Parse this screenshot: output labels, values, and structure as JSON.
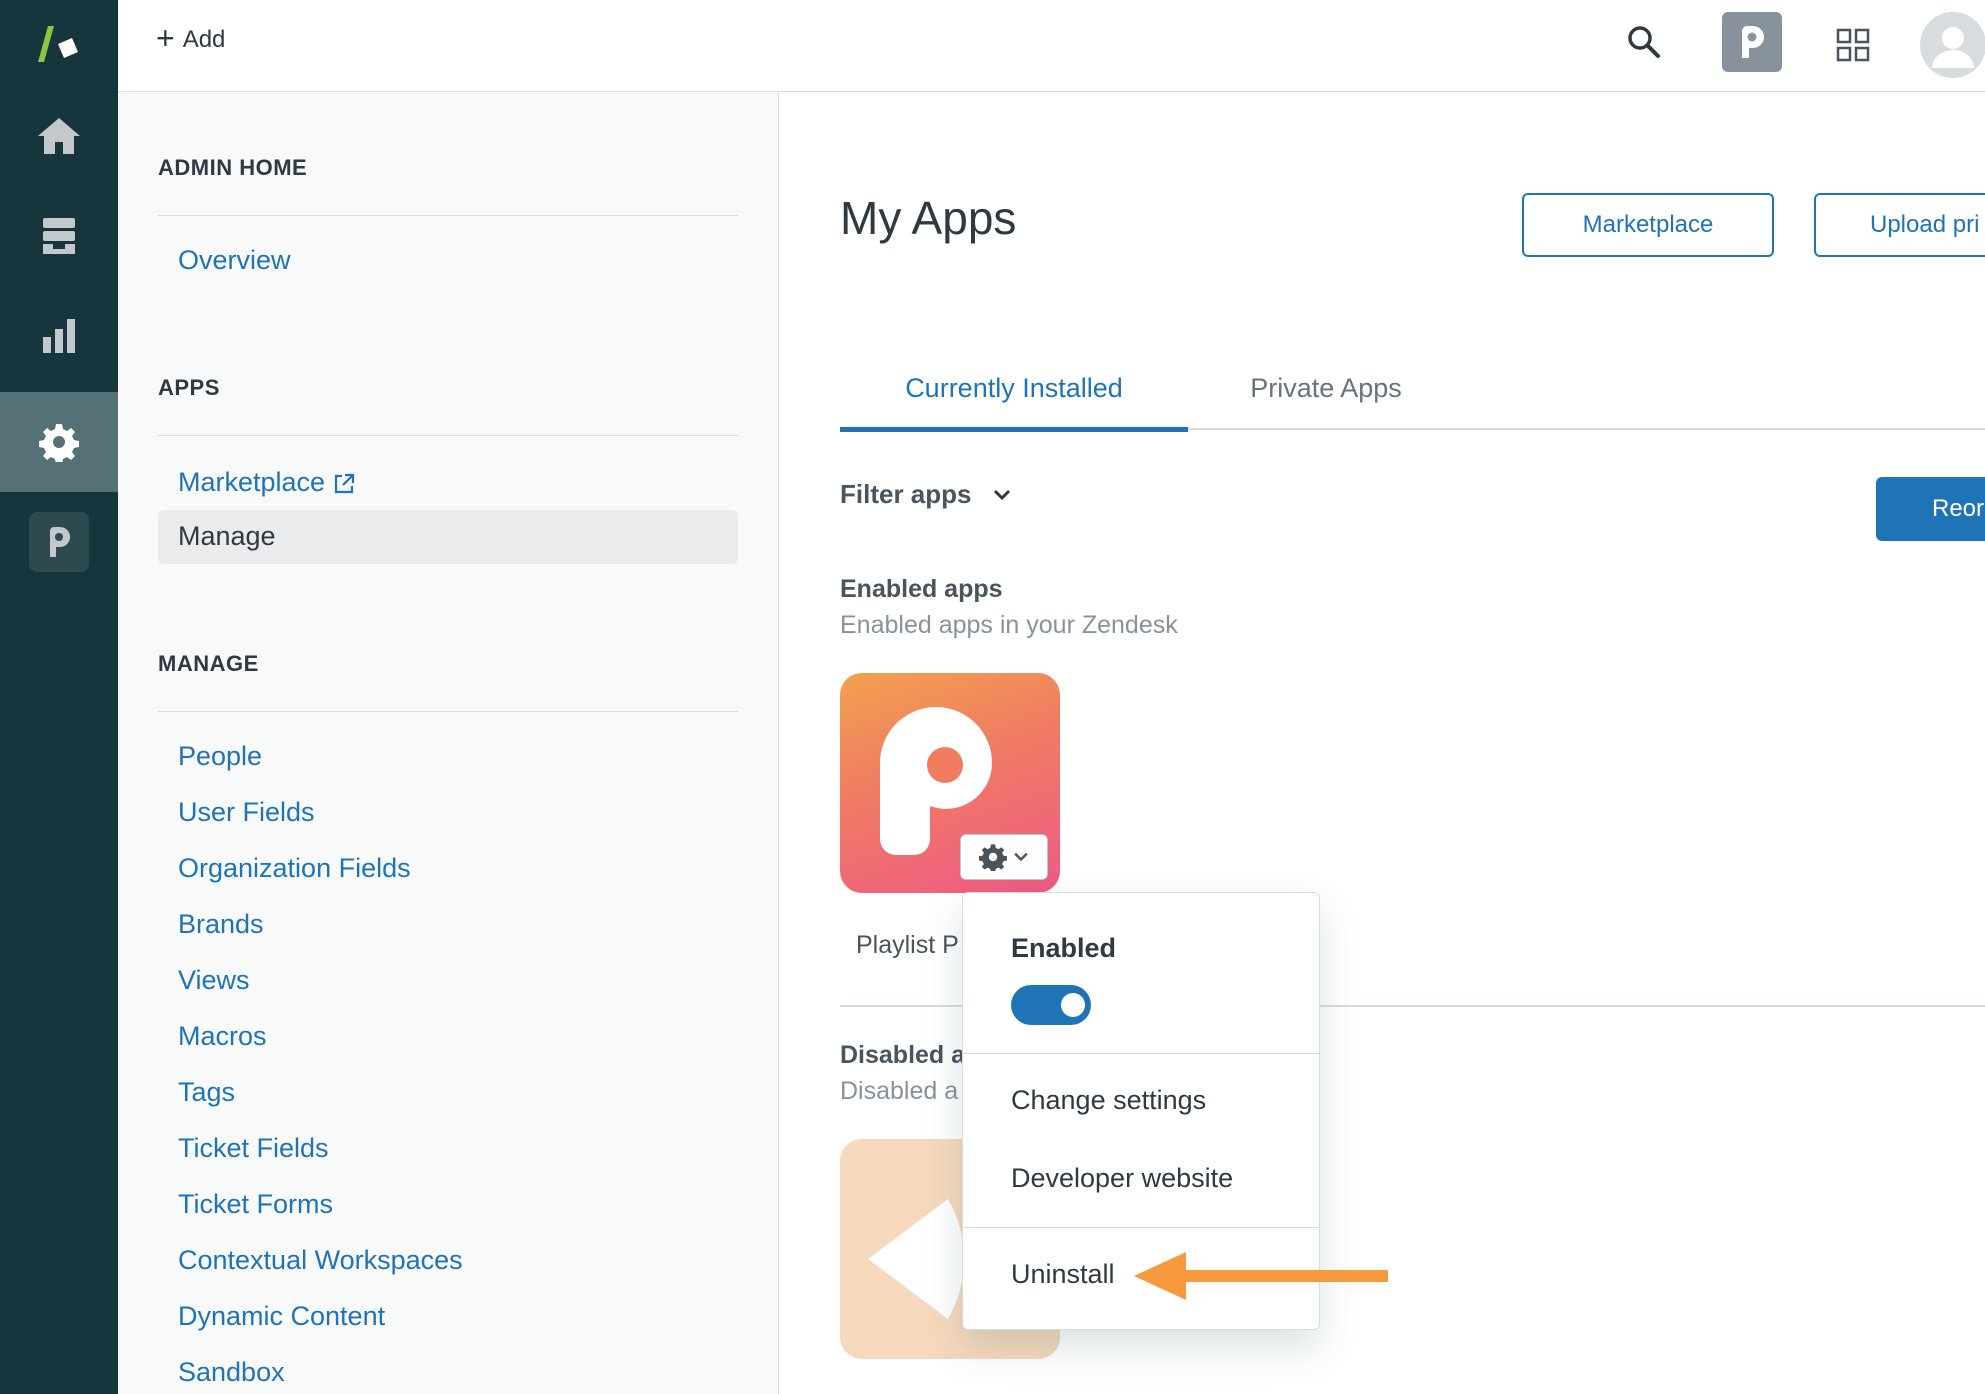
{
  "topbar": {
    "add_label": "Add"
  },
  "sidebar": {
    "admin_home_heading": "ADMIN HOME",
    "overview_label": "Overview",
    "apps_heading": "APPS",
    "marketplace_label": "Marketplace",
    "manage_selected_label": "Manage",
    "manage_heading": "MANAGE",
    "manage_items": [
      "People",
      "User Fields",
      "Organization Fields",
      "Brands",
      "Views",
      "Macros",
      "Tags",
      "Ticket Fields",
      "Ticket Forms",
      "Contextual Workspaces",
      "Dynamic Content",
      "Sandbox"
    ]
  },
  "main": {
    "title": "My Apps",
    "marketplace_button": "Marketplace",
    "upload_button": "Upload pri",
    "tabs": [
      "Currently Installed",
      "Private Apps"
    ],
    "filter_label": "Filter apps",
    "reorder_button": "Reor",
    "enabled_title": "Enabled apps",
    "enabled_subtitle": "Enabled apps in your Zendesk",
    "enabled_app_name": "Playlist P",
    "disabled_title": "Disabled a",
    "disabled_subtitle": "Disabled a"
  },
  "dropdown": {
    "enabled_label": "Enabled",
    "enabled": true,
    "change_settings": "Change settings",
    "developer_website": "Developer website",
    "uninstall": "Uninstall"
  },
  "colors": {
    "rail": "#17353d",
    "accent": "#1f73b7",
    "arrow": "#f79a3e"
  }
}
